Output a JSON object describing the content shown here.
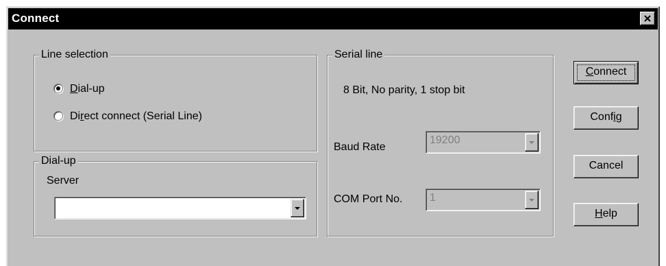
{
  "window": {
    "title": "Connect"
  },
  "line_selection": {
    "label": "Line selection",
    "options": [
      {
        "label": "Dial-up",
        "selected": true
      },
      {
        "label": "Direct connect (Serial Line)",
        "selected": false
      }
    ]
  },
  "dialup": {
    "label": "Dial-up",
    "server_label": "Server",
    "server_value": ""
  },
  "serial_line": {
    "label": "Serial line",
    "info": "8 Bit, No parity, 1 stop bit",
    "baud_rate_label": "Baud Rate",
    "baud_rate_value": "19200",
    "com_port_label": "COM Port No.",
    "com_port_value": "1"
  },
  "buttons": {
    "connect": "Connect",
    "config": "Config",
    "cancel": "Cancel",
    "help": "Help"
  },
  "icons": {
    "close": "close-icon",
    "radio_selected": "radio-selected-icon",
    "radio_unselected": "radio-unselected-icon",
    "dropdown": "chevron-down-icon"
  },
  "colors": {
    "title_bar": "#000000",
    "dialog_face": "#c0c0c0",
    "disabled_text": "#808080"
  }
}
